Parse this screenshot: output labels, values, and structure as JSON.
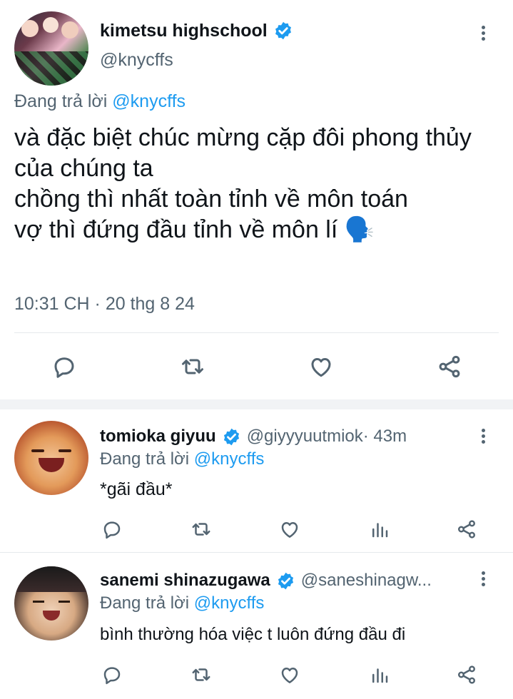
{
  "main_tweet": {
    "display_name": "kimetsu highschool",
    "handle": "@knycffs",
    "replying_prefix": "Đang trả lời",
    "replying_to": "@knycffs",
    "lines": [
      "và đặc biệt chúc mừng cặp đôi phong thủy",
      "của chúng ta",
      "chồng thì nhất toàn tỉnh về môn toán",
      "vợ thì đứng đầu tỉnh về môn lí 🗣️"
    ],
    "timestamp": "10:31 CH · 20 thg 8 24"
  },
  "replies": [
    {
      "display_name": "tomioka giyuu",
      "handle": "@giyyyuutmiok",
      "time": " · 43m",
      "replying_prefix": "Đang trả lời",
      "replying_to": "@knycffs",
      "text": "*gãi đầu*"
    },
    {
      "display_name": "sanemi shinazugawa",
      "handle": "@saneshinagw...",
      "time": "",
      "replying_prefix": "Đang trả lời",
      "replying_to": "@knycffs",
      "text": "bình thường hóa việc t luôn đứng đầu đi"
    }
  ],
  "colors": {
    "verified": "#1d9bf0",
    "link": "#1d9bf0",
    "text_secondary": "#536471"
  },
  "icons": [
    "reply-icon",
    "retweet-icon",
    "like-icon",
    "share-icon",
    "views-icon",
    "more-icon",
    "verified-icon"
  ]
}
